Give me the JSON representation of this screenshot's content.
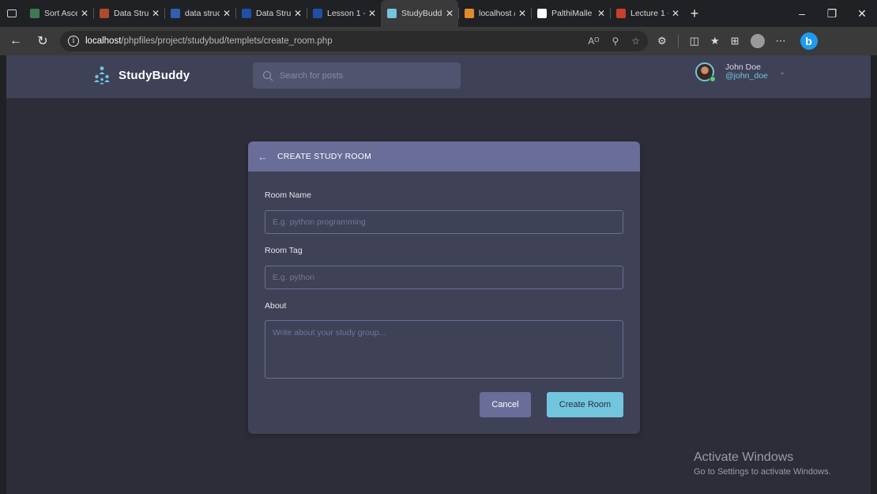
{
  "browser": {
    "tabs": [
      {
        "title": "Sort Ascen",
        "favicon_color": "#3c7a54",
        "favicon_glyph": "",
        "active": false
      },
      {
        "title": "Data Struct",
        "favicon_color": "#b04a2c",
        "favicon_glyph": "",
        "active": false
      },
      {
        "title": "data struct",
        "favicon_color": "#2f5fb5",
        "favicon_glyph": "",
        "active": false
      },
      {
        "title": "Data Struct",
        "favicon_color": "#1f4fa8",
        "favicon_glyph": "",
        "active": false
      },
      {
        "title": "Lesson 1 -",
        "favicon_color": "#1f4fa8",
        "favicon_glyph": "",
        "active": false
      },
      {
        "title": "StudyBudd",
        "favicon_color": "#71c6dd",
        "favicon_glyph": "",
        "active": true
      },
      {
        "title": "localhost /",
        "favicon_color": "#e08a2c",
        "favicon_glyph": "",
        "active": false
      },
      {
        "title": "PalthiMalle",
        "favicon_color": "#ffffff",
        "favicon_glyph": "",
        "active": false
      },
      {
        "title": "Lecture 1 -",
        "favicon_color": "#c8402c",
        "favicon_glyph": "",
        "active": false
      }
    ],
    "url_host": "localhost",
    "url_path": "/phpfiles/project/studybud/templets/create_room.php"
  },
  "app": {
    "brand": "StudyBuddy",
    "search_placeholder": "Search for posts",
    "user_name": "John Doe",
    "user_handle": "@john_doe",
    "accent": "#71c6dd",
    "primary": "#696d97"
  },
  "form": {
    "title": "CREATE STUDY ROOM",
    "room_name_label": "Room Name",
    "room_name_placeholder": "E.g. python programming",
    "room_tag_label": "Room Tag",
    "room_tag_placeholder": "E.g. python",
    "about_label": "About",
    "about_placeholder": "Write about your study group...",
    "cancel_label": "Cancel",
    "create_label": "Create Room"
  },
  "watermark": {
    "title": "Activate Windows",
    "subtitle": "Go to Settings to activate Windows."
  }
}
